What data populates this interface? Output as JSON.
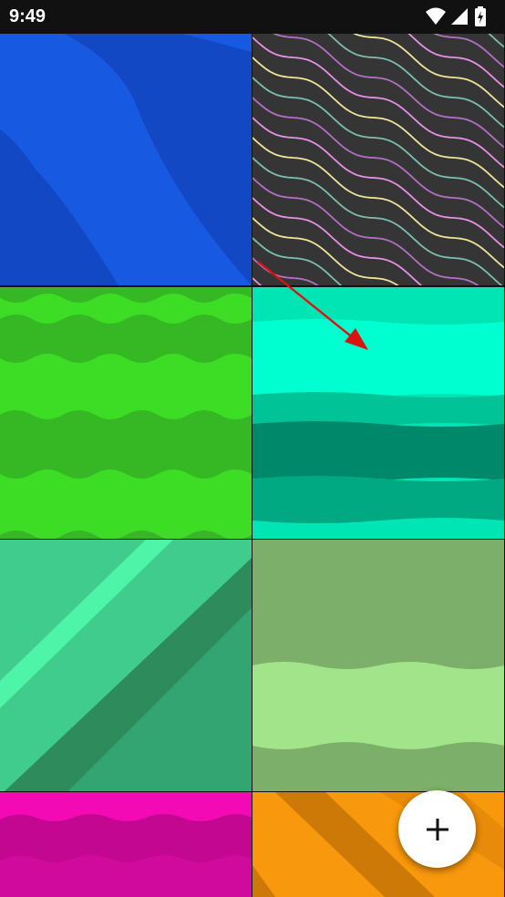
{
  "status_bar": {
    "time": "9:49",
    "icons": [
      "wifi-icon",
      "cellular-signal-icon",
      "battery-charging-icon"
    ]
  },
  "wallpapers": [
    {
      "row": 1,
      "column": 1,
      "pattern": "diagonal-bands",
      "colors": [
        "#1348c4",
        "#1759e0"
      ]
    },
    {
      "row": 1,
      "column": 2,
      "pattern": "diagonal-squiggles",
      "colors": [
        "#353535",
        "#e88fe8",
        "#efe59a",
        "#79c0b0",
        "#b56ec6"
      ]
    },
    {
      "row": 2,
      "column": 1,
      "pattern": "wavy-bands",
      "colors": [
        "#3ddd26",
        "#35b824"
      ]
    },
    {
      "row": 2,
      "column": 2,
      "pattern": "wavy-bands",
      "colors": [
        "#00e5b3",
        "#00ffd0",
        "#00c497",
        "#00886b",
        "#00a981"
      ]
    },
    {
      "row": 3,
      "column": 1,
      "pattern": "diagonal-bands",
      "colors": [
        "#3fcc8c",
        "#4ef5a8",
        "#2e8c5c",
        "#32a573"
      ]
    },
    {
      "row": 3,
      "column": 2,
      "pattern": "wavy-bands",
      "colors": [
        "#7cb06a",
        "#a1e48a"
      ]
    },
    {
      "row": 4,
      "column": 1,
      "pattern": "wavy-bands",
      "colors": [
        "#f30ab4",
        "#c40790"
      ]
    },
    {
      "row": 4,
      "column": 2,
      "pattern": "diagonal-bands",
      "colors": [
        "#f8980d",
        "#cc7908"
      ]
    }
  ],
  "fab": {
    "label": "+",
    "icon": "plus-icon"
  },
  "annotation": {
    "type": "arrow",
    "color": "#dd1111"
  }
}
